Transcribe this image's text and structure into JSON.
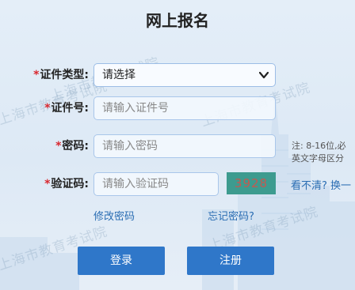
{
  "page": {
    "title": "网上报名"
  },
  "watermark": {
    "text": "上海市教育考试院"
  },
  "form": {
    "id_type": {
      "required_mark": "*",
      "label": "证件类型:",
      "selected": "请选择"
    },
    "id_number": {
      "required_mark": "*",
      "label": "证件号:",
      "placeholder": "请输入证件号"
    },
    "password": {
      "required_mark": "*",
      "label": "密码:",
      "placeholder": "请输入密码"
    },
    "captcha": {
      "required_mark": "*",
      "label": "验证码:",
      "placeholder": "请输入验证码",
      "code": "3928",
      "refresh_text": "看不清? 换一"
    }
  },
  "password_hint": {
    "line1": "注: 8-16位,必",
    "line2": "英文字母区分"
  },
  "links": {
    "change_password": "修改密码",
    "forgot_password": "忘记密码?"
  },
  "buttons": {
    "login": "登录",
    "register": "注册"
  },
  "colors": {
    "primary_button": "#2f77c9",
    "required": "#d9272e",
    "link": "#2a6db3",
    "captcha_bg": "#3d9b8f"
  },
  "icons": {
    "select_arrow": "chevron-down-icon"
  }
}
